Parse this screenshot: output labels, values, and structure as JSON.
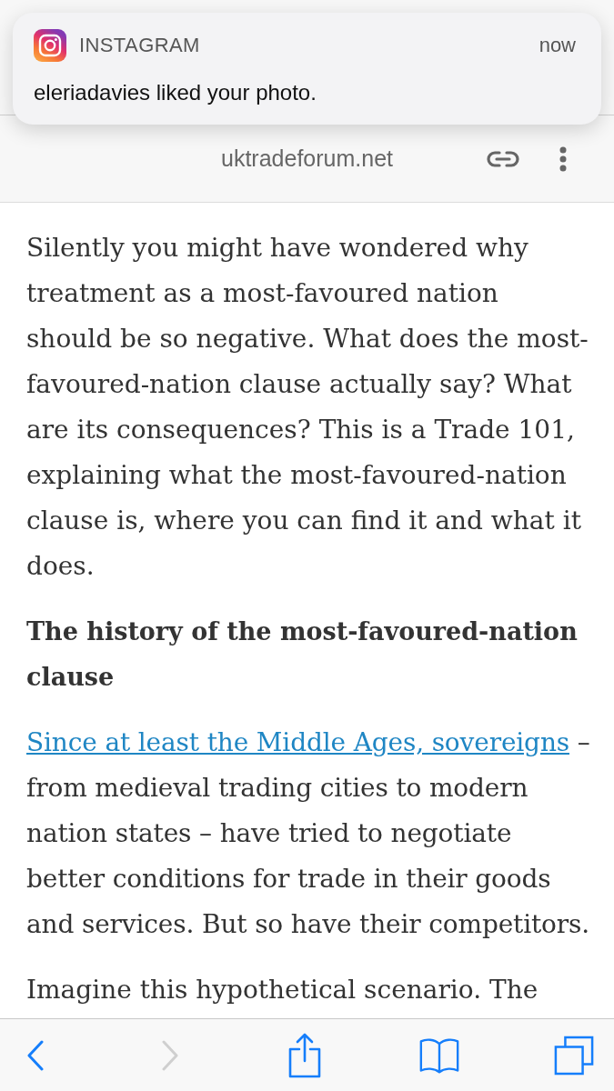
{
  "notification": {
    "app": "INSTAGRAM",
    "time": "now",
    "message": "eleriadavies liked your photo."
  },
  "address_bar": {
    "url": "uktradeforum.net"
  },
  "article": [
    {
      "kind": "paragraph",
      "text": "Silently you might have wondered why treatment as a most-favoured nation should be so negative. What does the most-favoured-nation clause actually say? What are its consequences? This is a Trade 101, explaining what the most-favoured-nation clause is, where you can find it and what it does."
    },
    {
      "kind": "heading",
      "text": "The history of the most-favoured-nation clause"
    },
    {
      "kind": "link_paragraph",
      "link": "Since at least the Middle Ages, sovereigns",
      "text": "– from medieval trading cities to modern nation states – have tried to negotiate better conditions for trade in their goods and services. But so have their competitors."
    },
    {
      "kind": "paragraph",
      "text": "Imagine this hypothetical scenario. The"
    }
  ],
  "toolbar": [
    {
      "kind": "back",
      "disabled": false
    },
    {
      "kind": "forward",
      "disabled": true
    },
    {
      "kind": "share",
      "disabled": false
    },
    {
      "kind": "bookmarks",
      "disabled": false
    },
    {
      "kind": "tabs",
      "disabled": false
    }
  ]
}
